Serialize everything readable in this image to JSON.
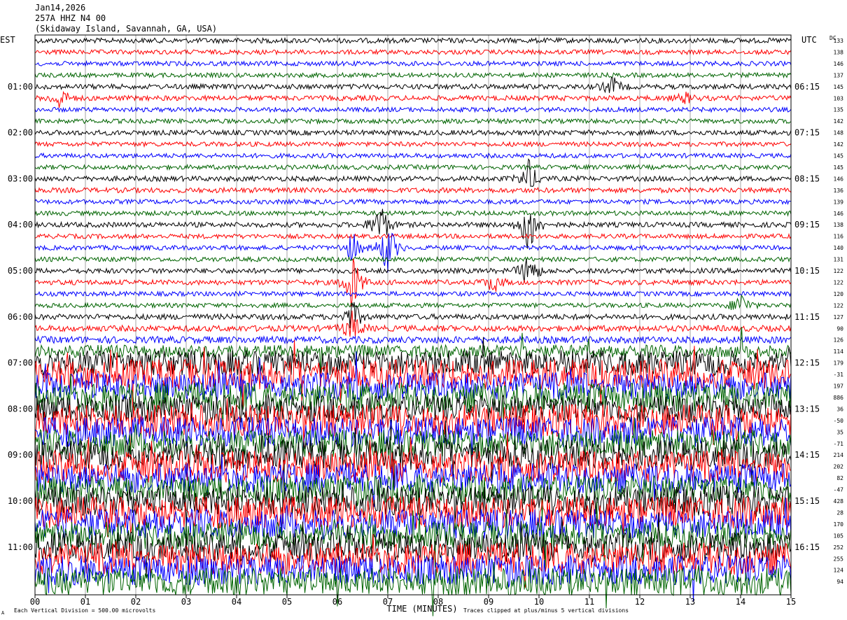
{
  "header": {
    "date": "Jan14,2026",
    "station": "257A HHZ N4 00",
    "location": "(Skidaway Island, Savannah, GA, USA)"
  },
  "left_zone": "EST",
  "right_zone": "UTC",
  "dc_label": "DC",
  "footer": {
    "scale_note": "Each Vertical Division =  500.00 microvolts",
    "clip_note": "Traces clipped at plus/minus 5 vertical divisions",
    "marker": "A"
  },
  "colors": {
    "trace_cycle": [
      "#000000",
      "#ff0000",
      "#0000ff",
      "#006400"
    ],
    "grid": "#000000"
  },
  "chart_data": {
    "type": "line",
    "title": "Jan14,2026 257A HHZ N4 00 (Skidaway Island, Savannah, GA, USA)",
    "xlabel": "TIME (MINUTES)",
    "xlim": [
      0,
      15
    ],
    "x_ticks": [
      "00",
      "01",
      "02",
      "03",
      "04",
      "05",
      "06",
      "07",
      "08",
      "09",
      "10",
      "11",
      "12",
      "13",
      "14",
      "15"
    ],
    "traces_per_hour": 4,
    "trace_count": 48,
    "est_ticks": [
      "01:00",
      "02:00",
      "03:00",
      "04:00",
      "05:00",
      "06:00",
      "07:00",
      "08:00",
      "09:00",
      "10:00",
      "11:00"
    ],
    "utc_ticks": [
      "06:15",
      "07:15",
      "08:15",
      "09:15",
      "10:15",
      "11:15",
      "12:15",
      "13:15",
      "14:15",
      "15:15",
      "16:15"
    ],
    "dc_offsets": [
      133,
      138,
      146,
      137,
      145,
      103,
      135,
      142,
      148,
      142,
      145,
      145,
      146,
      136,
      139,
      146,
      138,
      116,
      140,
      131,
      122,
      122,
      120,
      122,
      127,
      90,
      126,
      114,
      179,
      -31,
      197,
      886,
      36,
      -50,
      35,
      -71,
      214,
      202,
      82,
      -47,
      428,
      28,
      170,
      105,
      252,
      255,
      124,
      94
    ],
    "events": [
      {
        "trace": 4,
        "minute": 11.45,
        "amplitude": 0.9
      },
      {
        "trace": 5,
        "minute": 0.5,
        "amplitude": 1.0
      },
      {
        "trace": 5,
        "minute": 12.9,
        "amplitude": 0.5
      },
      {
        "trace": 12,
        "minute": 9.8,
        "amplitude": 1.6
      },
      {
        "trace": 16,
        "minute": 9.8,
        "amplitude": 3.0
      },
      {
        "trace": 16,
        "minute": 6.85,
        "amplitude": 2.2
      },
      {
        "trace": 18,
        "minute": 7.0,
        "amplitude": 2.6
      },
      {
        "trace": 18,
        "minute": 6.3,
        "amplitude": 1.4
      },
      {
        "trace": 20,
        "minute": 9.8,
        "amplitude": 1.8
      },
      {
        "trace": 21,
        "minute": 6.3,
        "amplitude": 2.8
      },
      {
        "trace": 21,
        "minute": 9.1,
        "amplitude": 0.9
      },
      {
        "trace": 24,
        "minute": 6.3,
        "amplitude": 1.5
      },
      {
        "trace": 25,
        "minute": 6.3,
        "amplitude": 1.4
      },
      {
        "trace": 23,
        "minute": 14.0,
        "amplitude": 1.2
      }
    ],
    "noise_level": [
      0.22,
      0.2,
      0.2,
      0.2,
      0.22,
      0.22,
      0.2,
      0.2,
      0.22,
      0.2,
      0.2,
      0.2,
      0.22,
      0.22,
      0.2,
      0.2,
      0.22,
      0.2,
      0.2,
      0.2,
      0.22,
      0.22,
      0.2,
      0.2,
      0.24,
      0.26,
      0.3,
      0.55,
      1.1,
      1.3,
      1.2,
      1.3,
      1.2,
      1.4,
      1.3,
      1.2,
      1.3,
      1.4,
      1.3,
      1.2,
      1.3,
      1.4,
      1.3,
      1.2,
      1.3,
      1.4,
      1.3,
      1.2
    ]
  }
}
